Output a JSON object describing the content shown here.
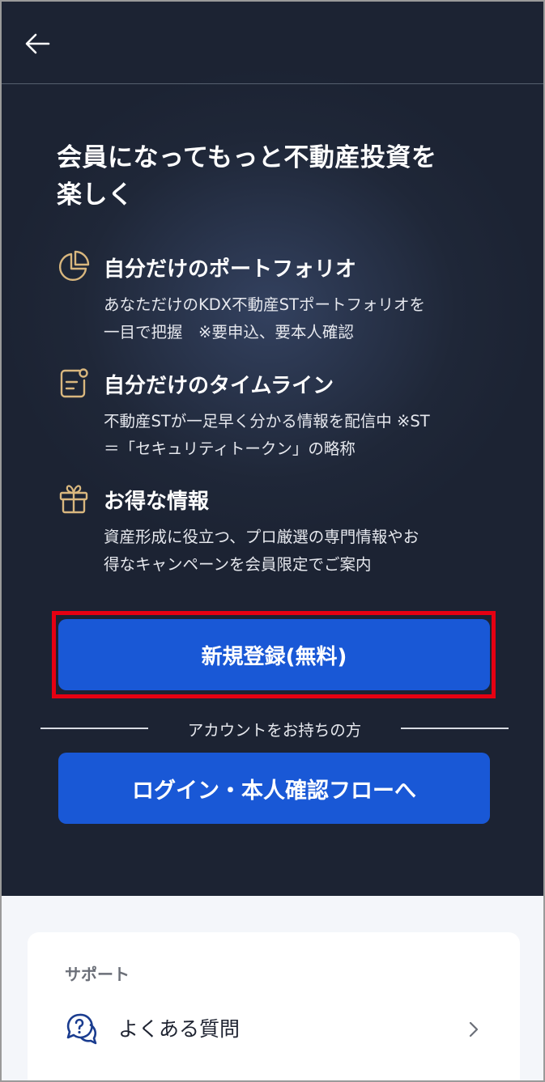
{
  "header": {
    "back_icon": "arrow-left-icon"
  },
  "hero": {
    "headline_line1": "会員になってもっと不動産投資を",
    "headline_line2": "楽しく"
  },
  "features": [
    {
      "icon": "pie-chart-icon",
      "title": "自分だけのポートフォリオ",
      "desc_line1": "あなただけのKDX不動産STポートフォリオを",
      "desc_line2": "一目で把握　※要申込、要本人確認"
    },
    {
      "icon": "notification-document-icon",
      "title": "自分だけのタイムライン",
      "desc_line1": "不動産STが一足早く分かる情報を配信中 ※ST",
      "desc_line2": "＝「セキュリティトークン」の略称"
    },
    {
      "icon": "gift-icon",
      "title": "お得な情報",
      "desc_line1": "資産形成に役立つ、プロ厳選の専門情報やお",
      "desc_line2": "得なキャンペーンを会員限定でご案内"
    }
  ],
  "actions": {
    "register_label": "新規登録(無料)",
    "divider_text": "アカウントをお持ちの方",
    "login_label": "ログイン・本人確認フローへ"
  },
  "support": {
    "title": "サポート",
    "faq_label": "よくある質問",
    "faq_icon": "question-chat-icon",
    "chevron_icon": "chevron-right-icon"
  },
  "colors": {
    "dark_bg": "#1f2738",
    "primary_button": "#1958d6",
    "accent_gold": "#d9b77e",
    "highlight_border": "#e60012"
  }
}
